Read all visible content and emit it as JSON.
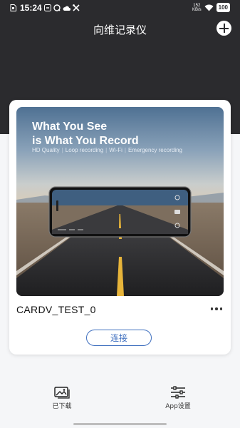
{
  "status_bar": {
    "time": "15:24",
    "net_speed_value": "152",
    "net_speed_unit": "KB/s",
    "battery": "100"
  },
  "header": {
    "title": "向维记录仪"
  },
  "device": {
    "banner_title_line1": "What You See",
    "banner_title_line2": "is What You Record",
    "features": [
      "HD Quality",
      "Loop recording",
      "Wi-Fi",
      "Emergency recording"
    ],
    "name": "CARDV_TEST_0",
    "connect_label": "连接"
  },
  "bottom_nav": [
    {
      "label": "已下载",
      "icon": "downloaded-images-icon"
    },
    {
      "label": "App设置",
      "icon": "settings-sliders-icon"
    }
  ],
  "colors": {
    "header_bg": "#2b2b2e",
    "accent": "#3f6fbf",
    "page_bg": "#f5f6f8"
  }
}
